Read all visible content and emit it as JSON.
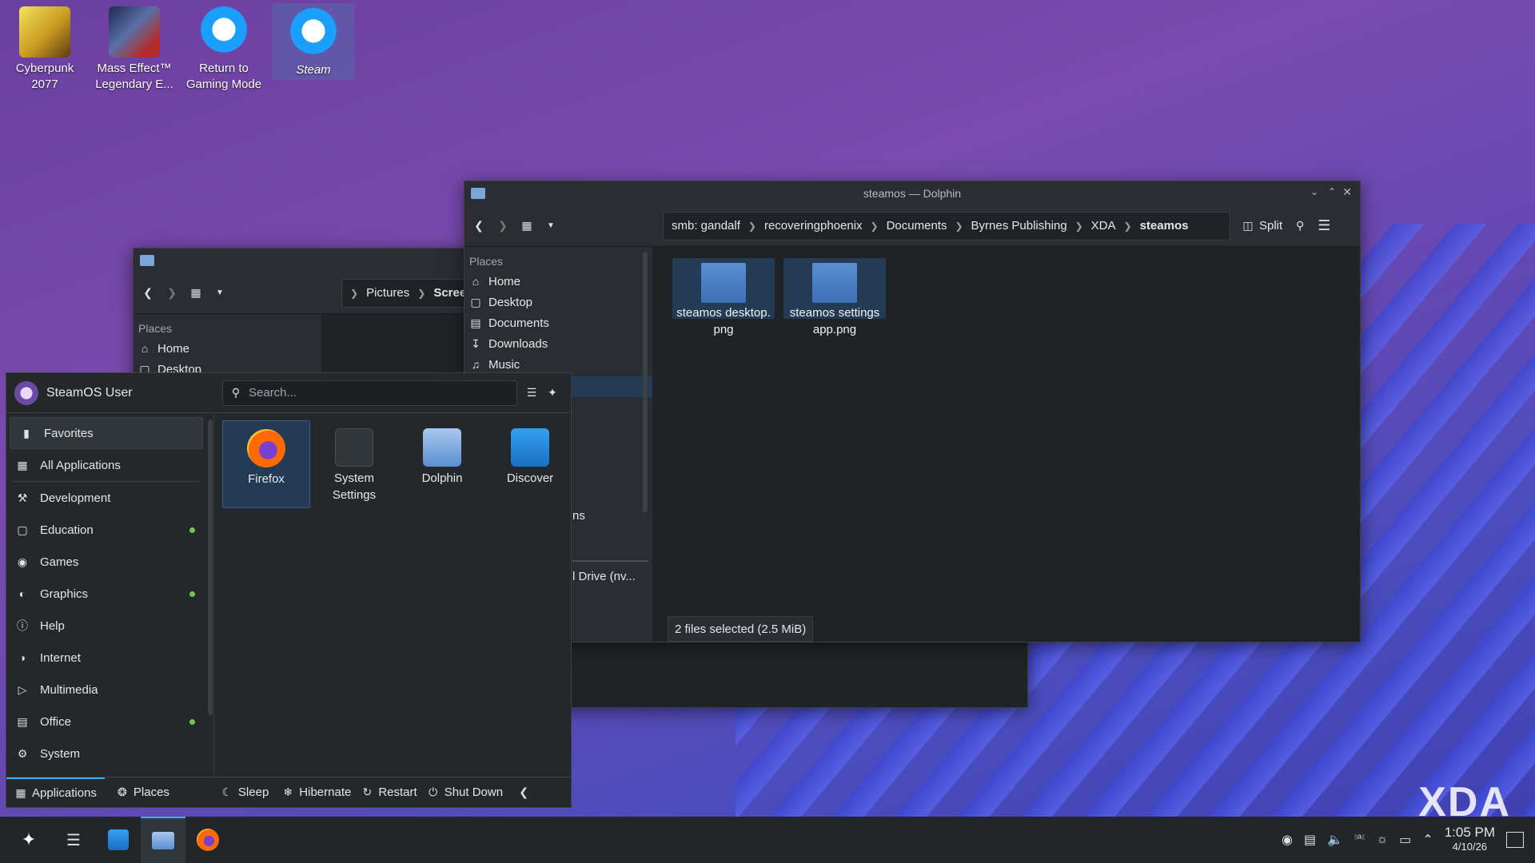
{
  "desktop": {
    "icons": [
      {
        "label_line1": "Cyberpunk",
        "label_line2": "2077"
      },
      {
        "label_line1": "Mass Effect™",
        "label_line2": "Legendary E..."
      },
      {
        "label_line1": "Return to",
        "label_line2": "Gaming Mode"
      },
      {
        "label_line1": "Steam",
        "label_line2": ""
      }
    ],
    "watermark": "XDA"
  },
  "back_window": {
    "breadcrumb": [
      "Pictures",
      "Scree"
    ],
    "places_header": "Places",
    "places": [
      "Home",
      "Desktop"
    ]
  },
  "dolphin": {
    "title": "steamos — Dolphin",
    "breadcrumb": [
      "smb: gandalf",
      "recoveringphoenix",
      "Documents",
      "Byrnes Publishing",
      "XDA",
      "steamos"
    ],
    "split_label": "Split",
    "places_header": "Places",
    "places": [
      "Home",
      "Desktop",
      "Documents",
      "Downloads",
      "Music"
    ],
    "partial_items": [
      "ns",
      "l Drive (nv..."
    ],
    "files": [
      {
        "line1": "steamos desktop.",
        "line2": "png"
      },
      {
        "line1": "steamos settings",
        "line2": "app.png"
      }
    ],
    "status": "2 files selected (2.5 MiB)"
  },
  "launcher": {
    "user": "SteamOS User",
    "search_placeholder": "Search...",
    "categories": [
      {
        "label": "Favorites",
        "icon": "bookmark-icon",
        "dot": false
      },
      {
        "label": "All Applications",
        "icon": "grid-icon",
        "dot": false
      },
      {
        "label": "Development",
        "icon": "hammer-icon",
        "dot": false
      },
      {
        "label": "Education",
        "icon": "monitor-icon",
        "dot": true
      },
      {
        "label": "Games",
        "icon": "gamepad-icon",
        "dot": false
      },
      {
        "label": "Graphics",
        "icon": "palette-icon",
        "dot": true
      },
      {
        "label": "Help",
        "icon": "info-icon",
        "dot": false
      },
      {
        "label": "Internet",
        "icon": "globe-icon",
        "dot": false
      },
      {
        "label": "Multimedia",
        "icon": "media-icon",
        "dot": false
      },
      {
        "label": "Office",
        "icon": "document-icon",
        "dot": true
      },
      {
        "label": "System",
        "icon": "gear-icon",
        "dot": false
      }
    ],
    "apps": [
      {
        "line1": "Firefox",
        "line2": ""
      },
      {
        "line1": "System",
        "line2": "Settings"
      },
      {
        "line1": "Dolphin",
        "line2": ""
      },
      {
        "line1": "Discover",
        "line2": ""
      }
    ],
    "footer": {
      "applications": "Applications",
      "places": "Places",
      "sleep": "Sleep",
      "hibernate": "Hibernate",
      "restart": "Restart",
      "shutdown": "Shut Down"
    }
  },
  "taskbar": {
    "time": "1:05 PM",
    "date": "4/10/26"
  },
  "colors": {
    "selection": "#243b55",
    "panel": "#2a2e32",
    "view": "#202326",
    "accent": "#3daee9",
    "dot": "#7fbf5a"
  }
}
